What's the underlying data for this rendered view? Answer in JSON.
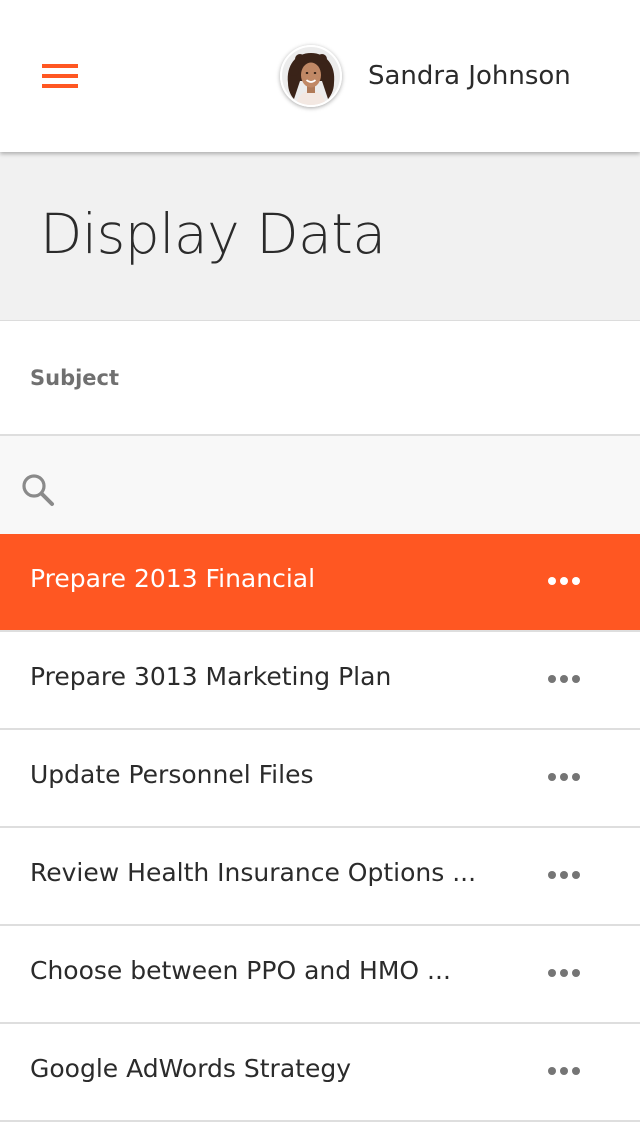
{
  "header": {
    "menu_icon": "hamburger-menu-icon",
    "user_name": "Sandra Johnson",
    "avatar_icon": "user-avatar"
  },
  "page": {
    "title": "Display Data"
  },
  "table": {
    "column_label": "Subject",
    "search": {
      "placeholder": "",
      "icon": "search-icon"
    },
    "rows": [
      {
        "subject": "Prepare 2013 Financial",
        "selected": true
      },
      {
        "subject": "Prepare 3013 Marketing Plan",
        "selected": false
      },
      {
        "subject": "Update Personnel Files",
        "selected": false
      },
      {
        "subject": "Review Health Insurance Options ...",
        "selected": false
      },
      {
        "subject": "Choose between PPO and HMO ...",
        "selected": false
      },
      {
        "subject": "Google AdWords Strategy",
        "selected": false
      }
    ],
    "row_action_icon": "more-options-icon"
  },
  "colors": {
    "accent": "#ff5722",
    "title_band": "#f1f1f1",
    "search_band": "#f8f8f8",
    "text": "#2b2b2b"
  }
}
